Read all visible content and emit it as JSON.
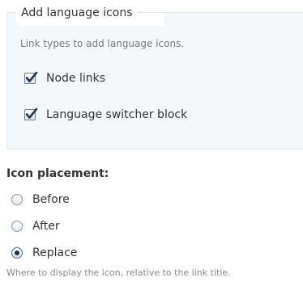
{
  "fieldset": {
    "legend": "Add language icons",
    "description": "Link types to add language icons.",
    "options": [
      {
        "label": "Node links",
        "checked": true
      },
      {
        "label": "Language switcher block",
        "checked": true
      }
    ]
  },
  "placement": {
    "title": "Icon placement:",
    "options": [
      {
        "label": "Before",
        "selected": false
      },
      {
        "label": "After",
        "selected": false
      },
      {
        "label": "Replace",
        "selected": true
      }
    ],
    "help": "Where to display the icon, relative to the link title."
  },
  "colors": {
    "panel_bg": "#f4f8fb",
    "panel_border": "#dfe5ea",
    "text": "#333333",
    "muted": "#777777",
    "check_mark": "#24344a"
  },
  "icons": {
    "checkbox_checked": "checkmark-icon"
  }
}
